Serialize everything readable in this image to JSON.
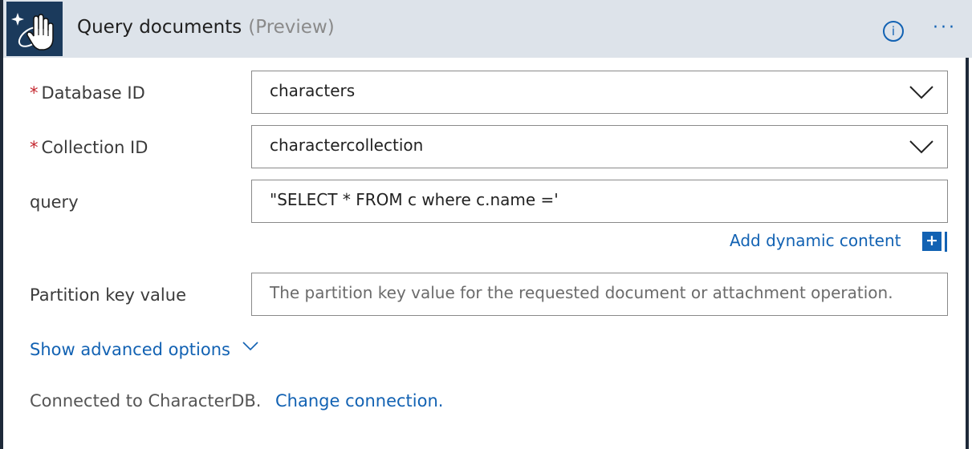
{
  "header": {
    "title": "Query documents",
    "subtitle": "(Preview)",
    "app_icon": "cosmosdb-sparkle-hand-icon",
    "info_icon": "info-icon",
    "more_icon": "more-ellipsis-icon",
    "info_glyph": "i",
    "more_glyph": "···"
  },
  "fields": {
    "database": {
      "label": "Database ID",
      "required_mark": "*",
      "value": "characters"
    },
    "collection": {
      "label": "Collection ID",
      "required_mark": "*",
      "value": "charactercollection"
    },
    "query": {
      "label": "query",
      "value": "\"SELECT * FROM c where c.name ='"
    },
    "partition": {
      "label": "Partition key value",
      "placeholder": "The partition key value for the requested document or attachment operation."
    }
  },
  "dynamic_content": {
    "label": "Add dynamic content",
    "icon_glyph": "+"
  },
  "advanced": {
    "label": "Show advanced options"
  },
  "connection": {
    "status": "Connected to CharacterDB.",
    "change_label": "Change connection."
  },
  "colors": {
    "accent": "#1262b3",
    "header_bg": "#dde3ea",
    "border": "#1e2a39",
    "required": "#c4262e"
  }
}
